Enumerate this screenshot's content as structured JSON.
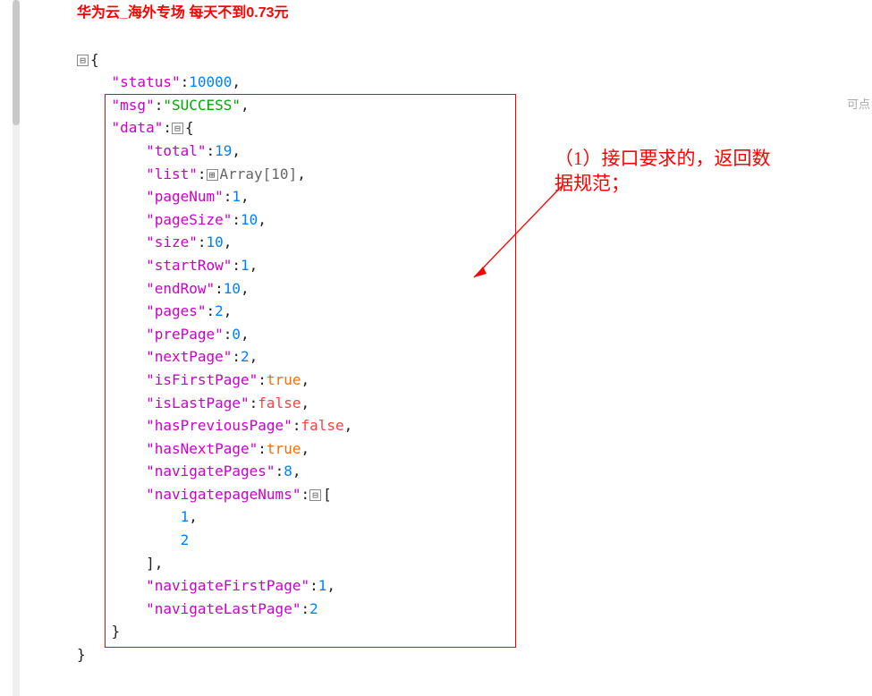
{
  "header": {
    "ad_text": "华为云_海外专场 每天不到0.73元"
  },
  "right_hint": "可点",
  "toggle": {
    "minus": "⊟",
    "plus": "⊞"
  },
  "json": {
    "brace_open": "{",
    "brace_close": "}",
    "bracket_open": "[",
    "bracket_close": "]",
    "colon": ":",
    "comma": ",",
    "status_key": "\"status\"",
    "status_val": "10000",
    "msg_key": "\"msg\"",
    "msg_val": "\"SUCCESS\"",
    "data_key": "\"data\"",
    "total_key": "\"total\"",
    "total_val": "19",
    "list_key": "\"list\"",
    "list_type": "Array[10]",
    "pageNum_key": "\"pageNum\"",
    "pageNum_val": "1",
    "pageSize_key": "\"pageSize\"",
    "pageSize_val": "10",
    "size_key": "\"size\"",
    "size_val": "10",
    "startRow_key": "\"startRow\"",
    "startRow_val": "1",
    "endRow_key": "\"endRow\"",
    "endRow_val": "10",
    "pages_key": "\"pages\"",
    "pages_val": "2",
    "prePage_key": "\"prePage\"",
    "prePage_val": "0",
    "nextPage_key": "\"nextPage\"",
    "nextPage_val": "2",
    "isFirstPage_key": "\"isFirstPage\"",
    "isFirstPage_val": "true",
    "isLastPage_key": "\"isLastPage\"",
    "isLastPage_val": "false",
    "hasPreviousPage_key": "\"hasPreviousPage\"",
    "hasPreviousPage_val": "false",
    "hasNextPage_key": "\"hasNextPage\"",
    "hasNextPage_val": "true",
    "navigatePages_key": "\"navigatePages\"",
    "navigatePages_val": "8",
    "navigatepageNums_key": "\"navigatepageNums\"",
    "npn_1": "1",
    "npn_2": "2",
    "navigateFirstPage_key": "\"navigateFirstPage\"",
    "navigateFirstPage_val": "1",
    "navigateLastPage_key": "\"navigateLastPage\"",
    "navigateLastPage_val": "2"
  },
  "annotation": {
    "line1": "（1）接口要求的，返回数",
    "line2": "据规范；"
  }
}
